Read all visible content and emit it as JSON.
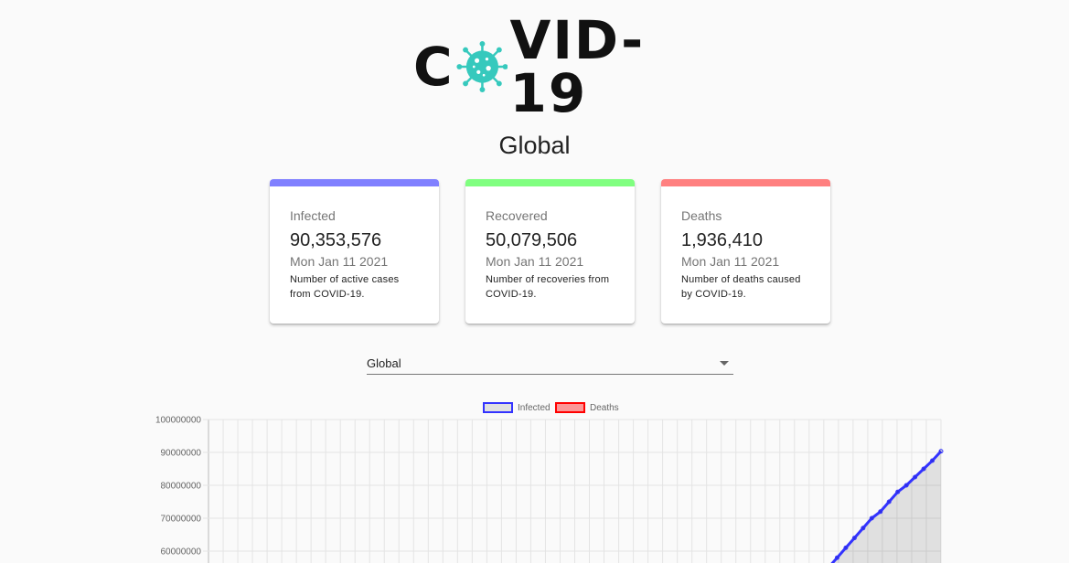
{
  "logo": {
    "text_left": "C",
    "text_right": "VID-19"
  },
  "region_title": "Global",
  "cards": [
    {
      "label": "Infected",
      "value": "90,353,576",
      "date": "Mon Jan 11 2021",
      "description": "Number of active cases from COVID-19.",
      "color": "#8080ff"
    },
    {
      "label": "Recovered",
      "value": "50,079,506",
      "date": "Mon Jan 11 2021",
      "description": "Number of recoveries from COVID-19.",
      "color": "#80ff80"
    },
    {
      "label": "Deaths",
      "value": "1,936,410",
      "date": "Mon Jan 11 2021",
      "description": "Number of deaths caused by COVID-19.",
      "color": "#ff8080"
    }
  ],
  "country_select": {
    "value": "Global"
  },
  "chart_data": {
    "type": "line",
    "legend": [
      "Infected",
      "Deaths"
    ],
    "legend_position": "top",
    "grid": true,
    "yticks": [
      "100000000",
      "90000000",
      "80000000",
      "70000000",
      "60000000"
    ],
    "ylim": [
      55000000,
      100000000
    ],
    "series": [
      {
        "name": "Infected",
        "color": "#3333ff",
        "fill": "rgba(0,0,0,0.1)",
        "values": [
          55000000,
          58000000,
          61000000,
          64000000,
          67000000,
          70000000,
          72000000,
          75000000,
          78000000,
          80000000,
          82500000,
          85000000,
          87500000,
          90353576
        ]
      },
      {
        "name": "Deaths",
        "color": "#ff0000",
        "fill": "rgba(255,0,0,0.4)",
        "values": []
      }
    ]
  }
}
